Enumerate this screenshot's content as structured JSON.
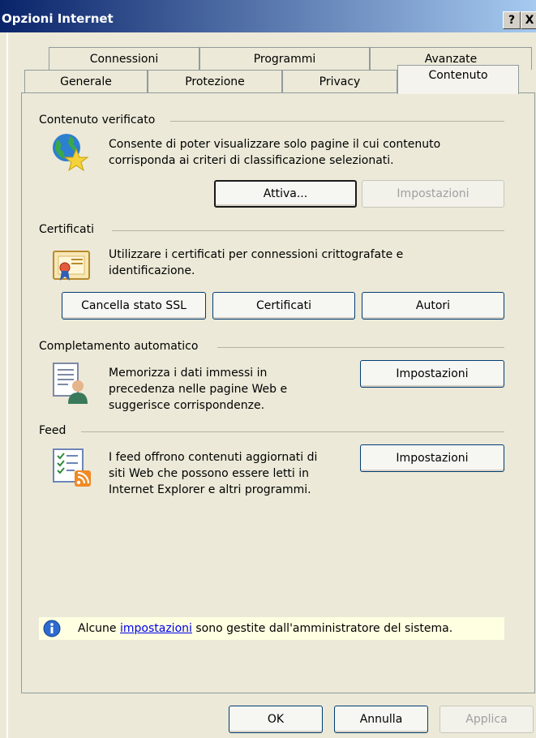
{
  "window": {
    "title": "Opzioni Internet",
    "help_button": "?",
    "close_button": "X"
  },
  "tabs_back": [
    "Connessioni",
    "Programmi",
    "Avanzate"
  ],
  "tabs_front": [
    "Generale",
    "Protezione",
    "Privacy",
    "Contenuto"
  ],
  "active_tab": "Contenuto",
  "sections": {
    "content_advisor": {
      "title": "Contenuto verificato",
      "description_line1": "Consente di poter visualizzare solo pagine il cui contenuto",
      "description_line2": "corrisponda ai criteri di classificazione selezionati.",
      "enable_button": "Attiva...",
      "settings_button": "Impostazioni",
      "icon": "globe-star-icon"
    },
    "certificates": {
      "title": "Certificati",
      "description_line1": "Utilizzare i certificati per connessioni crittografate e",
      "description_line2": "identificazione.",
      "clear_ssl_button": "Cancella stato SSL",
      "certificates_button": "Certificati",
      "publishers_button": "Autori",
      "icon": "certificate-icon"
    },
    "autocomplete": {
      "title": "Completamento automatico",
      "description_line1": "Memorizza i dati immessi in",
      "description_line2": "precedenza nelle pagine Web e",
      "description_line3": "suggerisce corrispondenze.",
      "settings_button": "Impostazioni",
      "icon": "user-form-icon"
    },
    "feeds": {
      "title": "Feed",
      "description_line1": "I feed offrono contenuti aggiornati di",
      "description_line2": "siti Web che possono essere letti in",
      "description_line3": "Internet Explorer e altri programmi.",
      "settings_button": "Impostazioni",
      "icon": "rss-feed-icon"
    }
  },
  "info_bar": {
    "prefix": "Alcune ",
    "link": "impostazioni",
    "suffix": " sono gestite dall'amministratore del sistema."
  },
  "footer": {
    "ok": "OK",
    "cancel": "Annulla",
    "apply": "Applica"
  }
}
